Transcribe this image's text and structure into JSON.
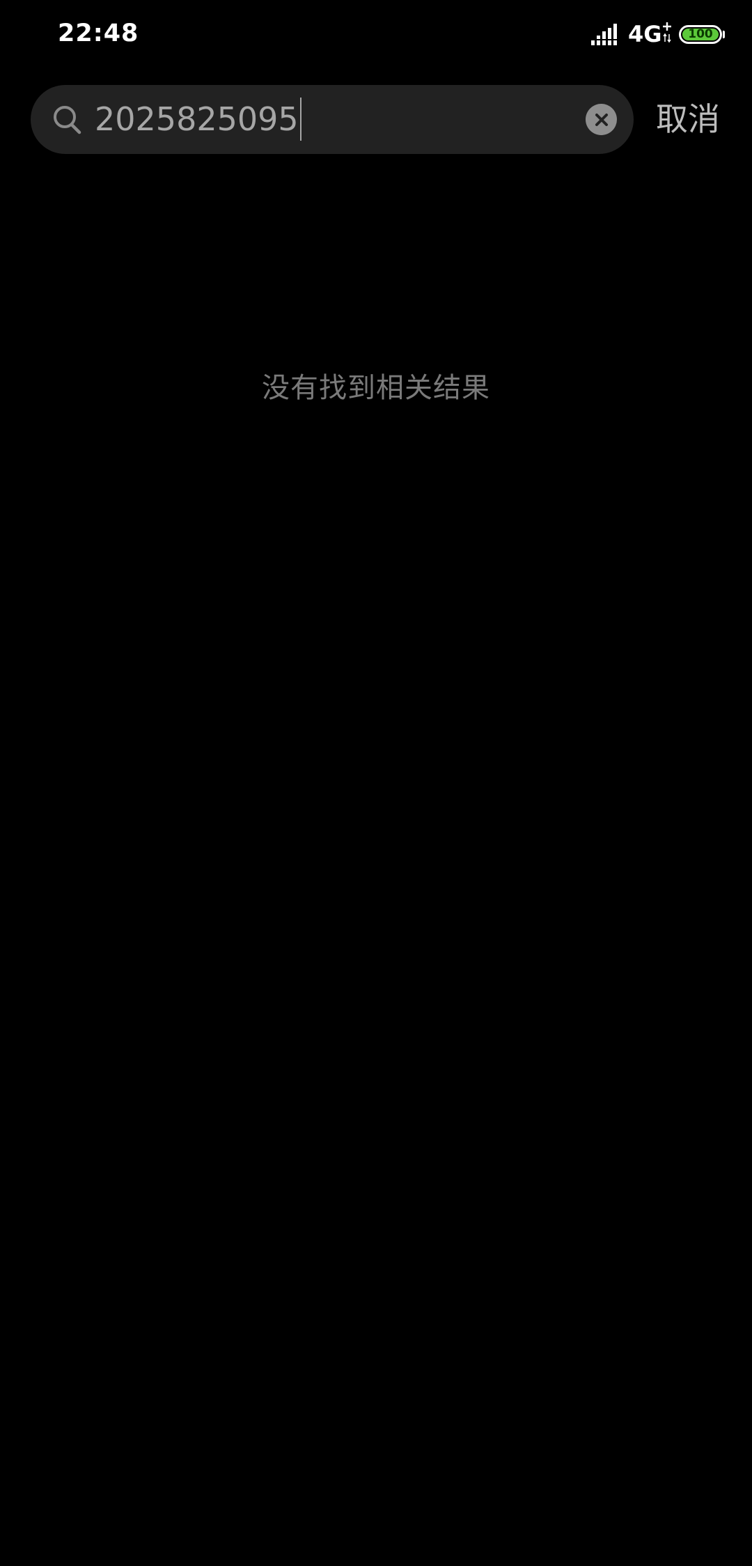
{
  "status_bar": {
    "time": "22:48",
    "network": "4G",
    "battery_level": "100",
    "signal_icon": "signal-bars-icon",
    "battery_color": "#5cc93a"
  },
  "search": {
    "value": "2025825095",
    "search_icon": "search-icon",
    "clear_icon": "close-icon",
    "cancel_label": "取消"
  },
  "results": {
    "empty_message": "没有找到相关结果"
  },
  "colors": {
    "background": "#000000",
    "search_bar": "#222222",
    "text_muted": "#7a7a7a"
  }
}
